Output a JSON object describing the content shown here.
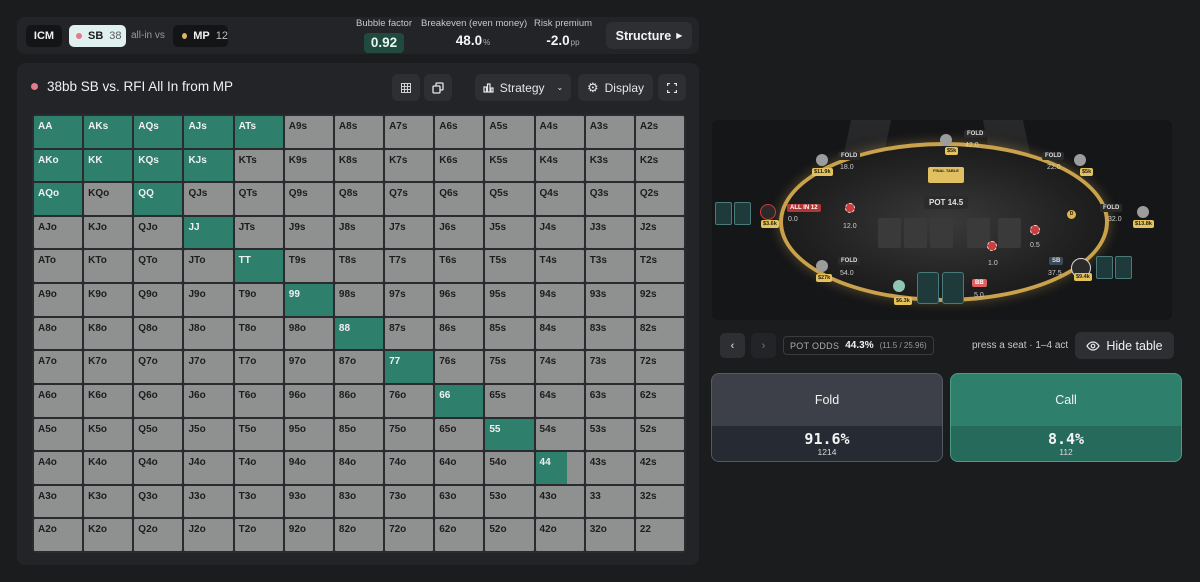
{
  "topbar": {
    "icm_label": "ICM",
    "hero_position": "SB",
    "hero_stack": "38",
    "vs_text": "all-in vs",
    "villain_position": "MP",
    "villain_stack": "12",
    "bubble_factor_label": "Bubble factor",
    "bubble_factor_value": "0.92",
    "breakeven_label": "Breakeven (even money)",
    "breakeven_value": "48.0",
    "breakeven_unit": "%",
    "risk_premium_label": "Risk premium",
    "risk_premium_value": "-2.0",
    "risk_premium_unit": "pp",
    "structure_label": "Structure"
  },
  "panel": {
    "title": "38bb SB vs. RFI All In from MP",
    "strategy_label": "Strategy",
    "display_label": "Display"
  },
  "colors": {
    "call_green": "#2f7f6d",
    "fold_gray": "#8f9090",
    "hero_dot": "#e47b8a",
    "villain_dot": "#d9b56a"
  },
  "hands": [
    [
      "AA",
      "AKs",
      "AQs",
      "AJs",
      "ATs",
      "A9s",
      "A8s",
      "A7s",
      "A6s",
      "A5s",
      "A4s",
      "A3s",
      "A2s"
    ],
    [
      "AKo",
      "KK",
      "KQs",
      "KJs",
      "KTs",
      "K9s",
      "K8s",
      "K7s",
      "K6s",
      "K5s",
      "K4s",
      "K3s",
      "K2s"
    ],
    [
      "AQo",
      "KQo",
      "QQ",
      "QJs",
      "QTs",
      "Q9s",
      "Q8s",
      "Q7s",
      "Q6s",
      "Q5s",
      "Q4s",
      "Q3s",
      "Q2s"
    ],
    [
      "AJo",
      "KJo",
      "QJo",
      "JJ",
      "JTs",
      "J9s",
      "J8s",
      "J7s",
      "J6s",
      "J5s",
      "J4s",
      "J3s",
      "J2s"
    ],
    [
      "ATo",
      "KTo",
      "QTo",
      "JTo",
      "TT",
      "T9s",
      "T8s",
      "T7s",
      "T6s",
      "T5s",
      "T4s",
      "T3s",
      "T2s"
    ],
    [
      "A9o",
      "K9o",
      "Q9o",
      "J9o",
      "T9o",
      "99",
      "98s",
      "97s",
      "96s",
      "95s",
      "94s",
      "93s",
      "92s"
    ],
    [
      "A8o",
      "K8o",
      "Q8o",
      "J8o",
      "T8o",
      "98o",
      "88",
      "87s",
      "86s",
      "85s",
      "84s",
      "83s",
      "82s"
    ],
    [
      "A7o",
      "K7o",
      "Q7o",
      "J7o",
      "T7o",
      "97o",
      "87o",
      "77",
      "76s",
      "75s",
      "74s",
      "73s",
      "72s"
    ],
    [
      "A6o",
      "K6o",
      "Q6o",
      "J6o",
      "T6o",
      "96o",
      "86o",
      "76o",
      "66",
      "65s",
      "64s",
      "63s",
      "62s"
    ],
    [
      "A5o",
      "K5o",
      "Q5o",
      "J5o",
      "T5o",
      "95o",
      "85o",
      "75o",
      "65o",
      "55",
      "54s",
      "53s",
      "52s"
    ],
    [
      "A4o",
      "K4o",
      "Q4o",
      "J4o",
      "T4o",
      "94o",
      "84o",
      "74o",
      "64o",
      "54o",
      "44",
      "43s",
      "42s"
    ],
    [
      "A3o",
      "K3o",
      "Q3o",
      "J3o",
      "T3o",
      "93o",
      "83o",
      "73o",
      "63o",
      "53o",
      "43o",
      "33",
      "32s"
    ],
    [
      "A2o",
      "K2o",
      "Q2o",
      "J2o",
      "T2o",
      "92o",
      "82o",
      "72o",
      "62o",
      "52o",
      "42o",
      "32o",
      "22"
    ]
  ],
  "call_frequency": [
    [
      1,
      1,
      1,
      1,
      1,
      0,
      0,
      0,
      0,
      0,
      0,
      0,
      0
    ],
    [
      1,
      1,
      1,
      1,
      0,
      0,
      0,
      0,
      0,
      0,
      0,
      0,
      0
    ],
    [
      1,
      0,
      1,
      0,
      0,
      0,
      0,
      0,
      0,
      0,
      0,
      0,
      0
    ],
    [
      0,
      0,
      0,
      1,
      0,
      0,
      0,
      0,
      0,
      0,
      0,
      0,
      0
    ],
    [
      0,
      0,
      0,
      0,
      1,
      0,
      0,
      0,
      0,
      0,
      0,
      0,
      0
    ],
    [
      0,
      0,
      0,
      0,
      0,
      1,
      0,
      0,
      0,
      0,
      0,
      0,
      0
    ],
    [
      0,
      0,
      0,
      0,
      0,
      0,
      1,
      0,
      0,
      0,
      0,
      0,
      0
    ],
    [
      0,
      0,
      0,
      0,
      0,
      0,
      0,
      1,
      0,
      0,
      0,
      0,
      0
    ],
    [
      0,
      0,
      0,
      0,
      0,
      0,
      0,
      0,
      1,
      0,
      0,
      0,
      0
    ],
    [
      0,
      0,
      0,
      0,
      0,
      0,
      0,
      0,
      0,
      1,
      0,
      0,
      0
    ],
    [
      0,
      0,
      0,
      0,
      0,
      0,
      0,
      0,
      0,
      0,
      0.65,
      0,
      0
    ],
    [
      0,
      0,
      0,
      0,
      0,
      0,
      0,
      0,
      0,
      0,
      0,
      0,
      0
    ],
    [
      0,
      0,
      0,
      0,
      0,
      0,
      0,
      0,
      0,
      0,
      0,
      0,
      0
    ]
  ],
  "table": {
    "pot_label": "POT",
    "pot_value": "14.5",
    "final_table_line1": "FINAL TABLE",
    "final_table_line2": "",
    "allin_label": "ALL IN 12",
    "hero_pos_label": "SB",
    "seats": [
      {
        "tag": "FOLD",
        "chips": "42.0",
        "stack": "$5k"
      },
      {
        "tag": "FOLD",
        "chips": "18.0",
        "stack": "$11.9k"
      },
      {
        "tag": "FOLD",
        "chips": "22.0",
        "stack": "$5k"
      },
      {
        "tag": "FOLD",
        "chips": "32.0",
        "stack": "$13.8k"
      },
      {
        "tag": "FOLD",
        "chips": "54.0",
        "stack": "$27k"
      },
      {
        "tag": "",
        "chips": "0.0",
        "stack": "$3.6k"
      },
      {
        "tag": "",
        "chips": "37.5",
        "stack": "$9.4k"
      },
      {
        "tag": "BB",
        "chips": "5.0",
        "stack": "$6.3k"
      }
    ],
    "bets": [
      "12.0",
      "1.0",
      "0.5"
    ],
    "dealer_label": "D"
  },
  "odds": {
    "label": "POT ODDS",
    "percent": "44.3%",
    "detail": "(11.5 / 25.96)",
    "hint": "press a seat · 1–4 act",
    "hide_table_label": "Hide table"
  },
  "actions": {
    "fold_label": "Fold",
    "fold_pct": "91.6%",
    "fold_combos": "1214",
    "call_label": "Call",
    "call_pct": "8.4%",
    "call_combos": "112"
  }
}
